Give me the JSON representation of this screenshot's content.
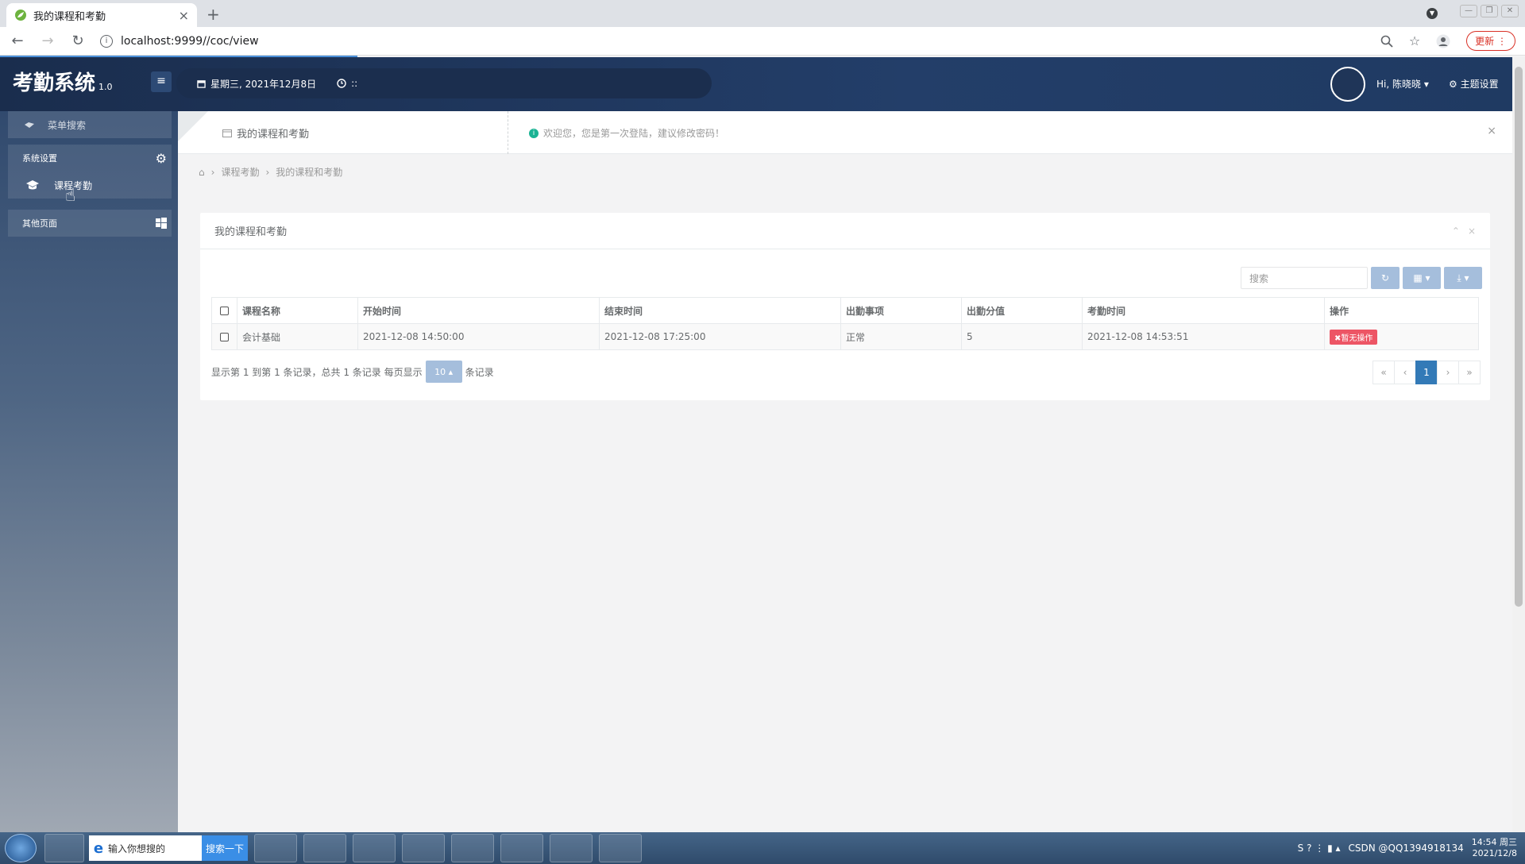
{
  "browser": {
    "tab_title": "我的课程和考勤",
    "tab_close": "×",
    "new_tab": "+",
    "url": "localhost:9999//coc/view",
    "update_label": "更新"
  },
  "header": {
    "app_title": "考勤系统",
    "version": "1.0",
    "date_text": "星期三, 2021年12月8日",
    "time_text": "::",
    "greeting": "Hi, 陈晓晓",
    "theme_label": "主题设置"
  },
  "sidebar": {
    "search_placeholder": "菜单搜索",
    "groups": [
      {
        "label": "系统设置",
        "items": [
          {
            "label": "课程考勤"
          }
        ]
      },
      {
        "label": "其他页面",
        "items": []
      }
    ]
  },
  "page_tab": {
    "label": "我的课程和考勤",
    "notice": "欢迎您，您是第一次登陆，建议修改密码！"
  },
  "breadcrumb": {
    "items": [
      "课程考勤",
      "我的课程和考勤"
    ]
  },
  "panel": {
    "title": "我的课程和考勤",
    "search_placeholder": "搜索",
    "columns": [
      "课程名称",
      "开始时间",
      "结束时间",
      "出勤事项",
      "出勤分值",
      "考勤时间",
      "操作"
    ],
    "rows": [
      {
        "course": "会计基础",
        "start": "2021-12-08 14:50:00",
        "end": "2021-12-08 17:25:00",
        "status": "正常",
        "score": "5",
        "check_time": "2021-12-08 14:53:51",
        "action": "✖暂无操作"
      }
    ],
    "pager_text_1": "显示第 1 到第 1 条记录，总共 1 条记录 每页显示",
    "page_size": "10",
    "pager_text_2": "条记录",
    "pages": [
      "«",
      "‹",
      "1",
      "›",
      "»"
    ],
    "current_page": "1"
  },
  "taskbar": {
    "search_placeholder": "输入你想搜的",
    "search_button": "搜索一下",
    "watermark": "CSDN @QQ1394918134",
    "time": "14:54 周三",
    "date": "2021/12/8"
  },
  "colors": {
    "header_bg": "#1f3a62",
    "accent": "#337ab7",
    "danger": "#ed5565",
    "success": "#1ab394"
  }
}
